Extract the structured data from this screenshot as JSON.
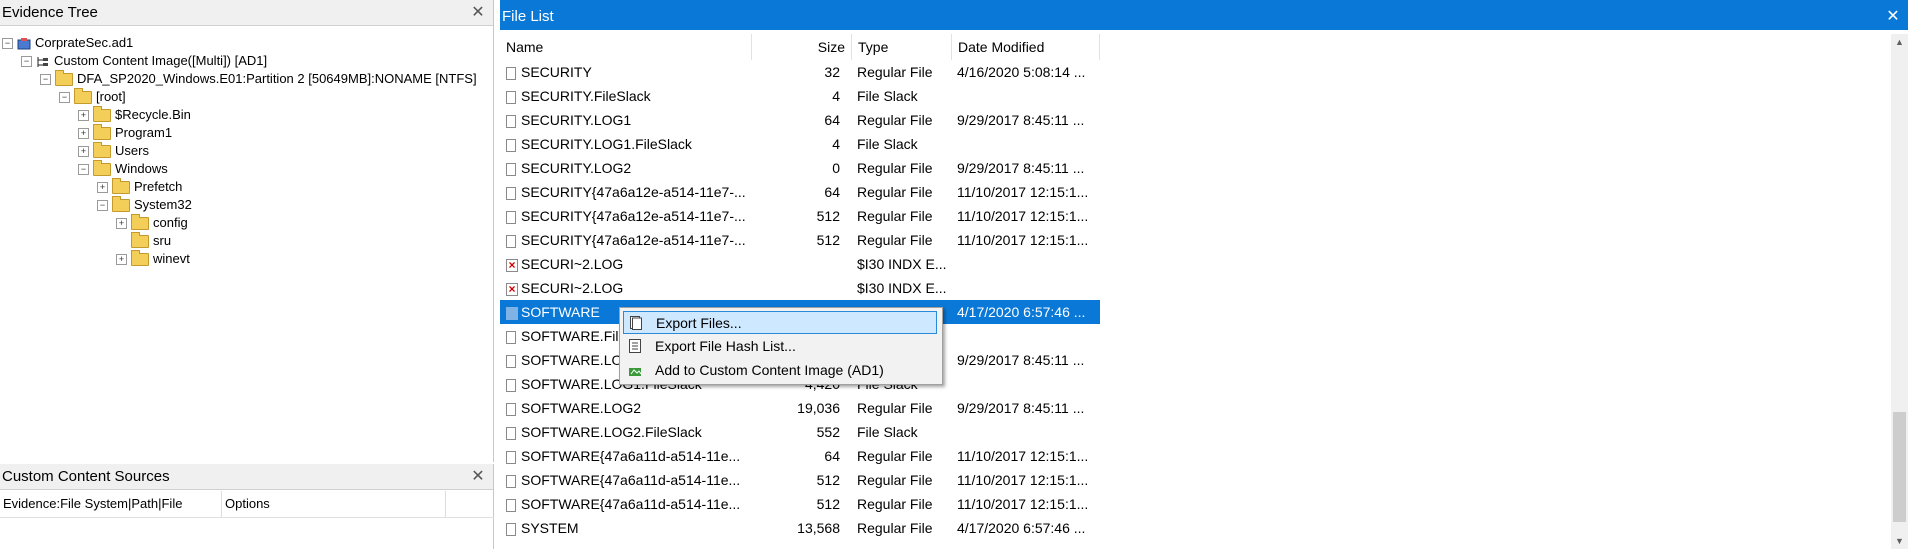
{
  "evidence_tree": {
    "title": "Evidence Tree",
    "close": "✕",
    "nodes": [
      {
        "label": "CorprateSec.ad1",
        "expander": "−",
        "icon": "evidence-icon"
      },
      {
        "label": "Custom Content Image([Multi]) [AD1]",
        "expander": "−",
        "icon": "tree-structure-icon"
      },
      {
        "label": "DFA_SP2020_Windows.E01:Partition 2 [50649MB]:NONAME [NTFS]",
        "expander": "−",
        "icon": "folder-icon"
      },
      {
        "label": "[root]",
        "expander": "−",
        "icon": "folder-icon"
      },
      {
        "label": "$Recycle.Bin",
        "expander": "+",
        "icon": "folder-icon"
      },
      {
        "label": "Program1",
        "expander": "+",
        "icon": "folder-icon"
      },
      {
        "label": "Users",
        "expander": "+",
        "icon": "folder-icon"
      },
      {
        "label": "Windows",
        "expander": "−",
        "icon": "folder-icon"
      },
      {
        "label": "Prefetch",
        "expander": "+",
        "icon": "folder-icon"
      },
      {
        "label": "System32",
        "expander": "−",
        "icon": "folder-icon"
      },
      {
        "label": "config",
        "expander": "+",
        "icon": "folder-icon"
      },
      {
        "label": "sru",
        "expander": "",
        "icon": "folder-icon"
      },
      {
        "label": "winevt",
        "expander": "+",
        "icon": "folder-icon"
      }
    ]
  },
  "custom_content_sources": {
    "title": "Custom Content Sources",
    "close": "✕",
    "columns": [
      "Evidence:File System|Path|File",
      "Options"
    ]
  },
  "file_list": {
    "title": "File List",
    "close": "✕",
    "columns": {
      "name": "Name",
      "size": "Size",
      "type": "Type",
      "date": "Date Modified"
    },
    "rows": [
      {
        "name": "SECURITY",
        "size": "32",
        "type": "Regular File",
        "date": "4/16/2020 5:08:14 ...",
        "icon": "file"
      },
      {
        "name": "SECURITY.FileSlack",
        "size": "4",
        "type": "File Slack",
        "date": "",
        "icon": "file"
      },
      {
        "name": "SECURITY.LOG1",
        "size": "64",
        "type": "Regular File",
        "date": "9/29/2017 8:45:11 ...",
        "icon": "file"
      },
      {
        "name": "SECURITY.LOG1.FileSlack",
        "size": "4",
        "type": "File Slack",
        "date": "",
        "icon": "file"
      },
      {
        "name": "SECURITY.LOG2",
        "size": "0",
        "type": "Regular File",
        "date": "9/29/2017 8:45:11 ...",
        "icon": "file"
      },
      {
        "name": "SECURITY{47a6a12e-a514-11e7-...",
        "size": "64",
        "type": "Regular File",
        "date": "11/10/2017 12:15:1...",
        "icon": "file"
      },
      {
        "name": "SECURITY{47a6a12e-a514-11e7-...",
        "size": "512",
        "type": "Regular File",
        "date": "11/10/2017 12:15:1...",
        "icon": "file"
      },
      {
        "name": "SECURITY{47a6a12e-a514-11e7-...",
        "size": "512",
        "type": "Regular File",
        "date": "11/10/2017 12:15:1...",
        "icon": "file"
      },
      {
        "name": "SECURI~2.LOG",
        "size": "",
        "type": "$I30 INDX E...",
        "date": "",
        "icon": "deleted"
      },
      {
        "name": "SECURI~2.LOG",
        "size": "",
        "type": "$I30 INDX E...",
        "date": "",
        "icon": "deleted"
      },
      {
        "name": "SOFTWARE",
        "size": "",
        "type": "",
        "date": "4/17/2020 6:57:46 ...",
        "icon": "file",
        "selected": true
      },
      {
        "name": "SOFTWARE.File",
        "size": "",
        "type": "",
        "date": "",
        "icon": "file"
      },
      {
        "name": "SOFTWARE.LO",
        "size": "",
        "type": "",
        "date": "9/29/2017 8:45:11 ...",
        "icon": "file"
      },
      {
        "name": "SOFTWARE.LOG1.FileSlack",
        "size": "4,420",
        "type": "File Slack",
        "date": "",
        "icon": "file"
      },
      {
        "name": "SOFTWARE.LOG2",
        "size": "19,036",
        "type": "Regular File",
        "date": "9/29/2017 8:45:11 ...",
        "icon": "file"
      },
      {
        "name": "SOFTWARE.LOG2.FileSlack",
        "size": "552",
        "type": "File Slack",
        "date": "",
        "icon": "file"
      },
      {
        "name": "SOFTWARE{47a6a11d-a514-11e...",
        "size": "64",
        "type": "Regular File",
        "date": "11/10/2017 12:15:1...",
        "icon": "file"
      },
      {
        "name": "SOFTWARE{47a6a11d-a514-11e...",
        "size": "512",
        "type": "Regular File",
        "date": "11/10/2017 12:15:1...",
        "icon": "file"
      },
      {
        "name": "SOFTWARE{47a6a11d-a514-11e...",
        "size": "512",
        "type": "Regular File",
        "date": "11/10/2017 12:15:1...",
        "icon": "file"
      },
      {
        "name": "SYSTEM",
        "size": "13,568",
        "type": "Regular File",
        "date": "4/17/2020 6:57:46 ...",
        "icon": "file"
      }
    ]
  },
  "context_menu": {
    "items": [
      {
        "label": "Export Files...",
        "icon": "export-files-icon",
        "highlighted": true
      },
      {
        "label": "Export File Hash List...",
        "icon": "hash-list-icon",
        "highlighted": false
      },
      {
        "label": "Add to Custom Content Image (AD1)",
        "icon": "add-image-icon",
        "highlighted": false
      }
    ]
  },
  "colors": {
    "accent": "#0a78d7",
    "menu_highlight": "#cde8ff",
    "folder": "#f3cf5a"
  }
}
